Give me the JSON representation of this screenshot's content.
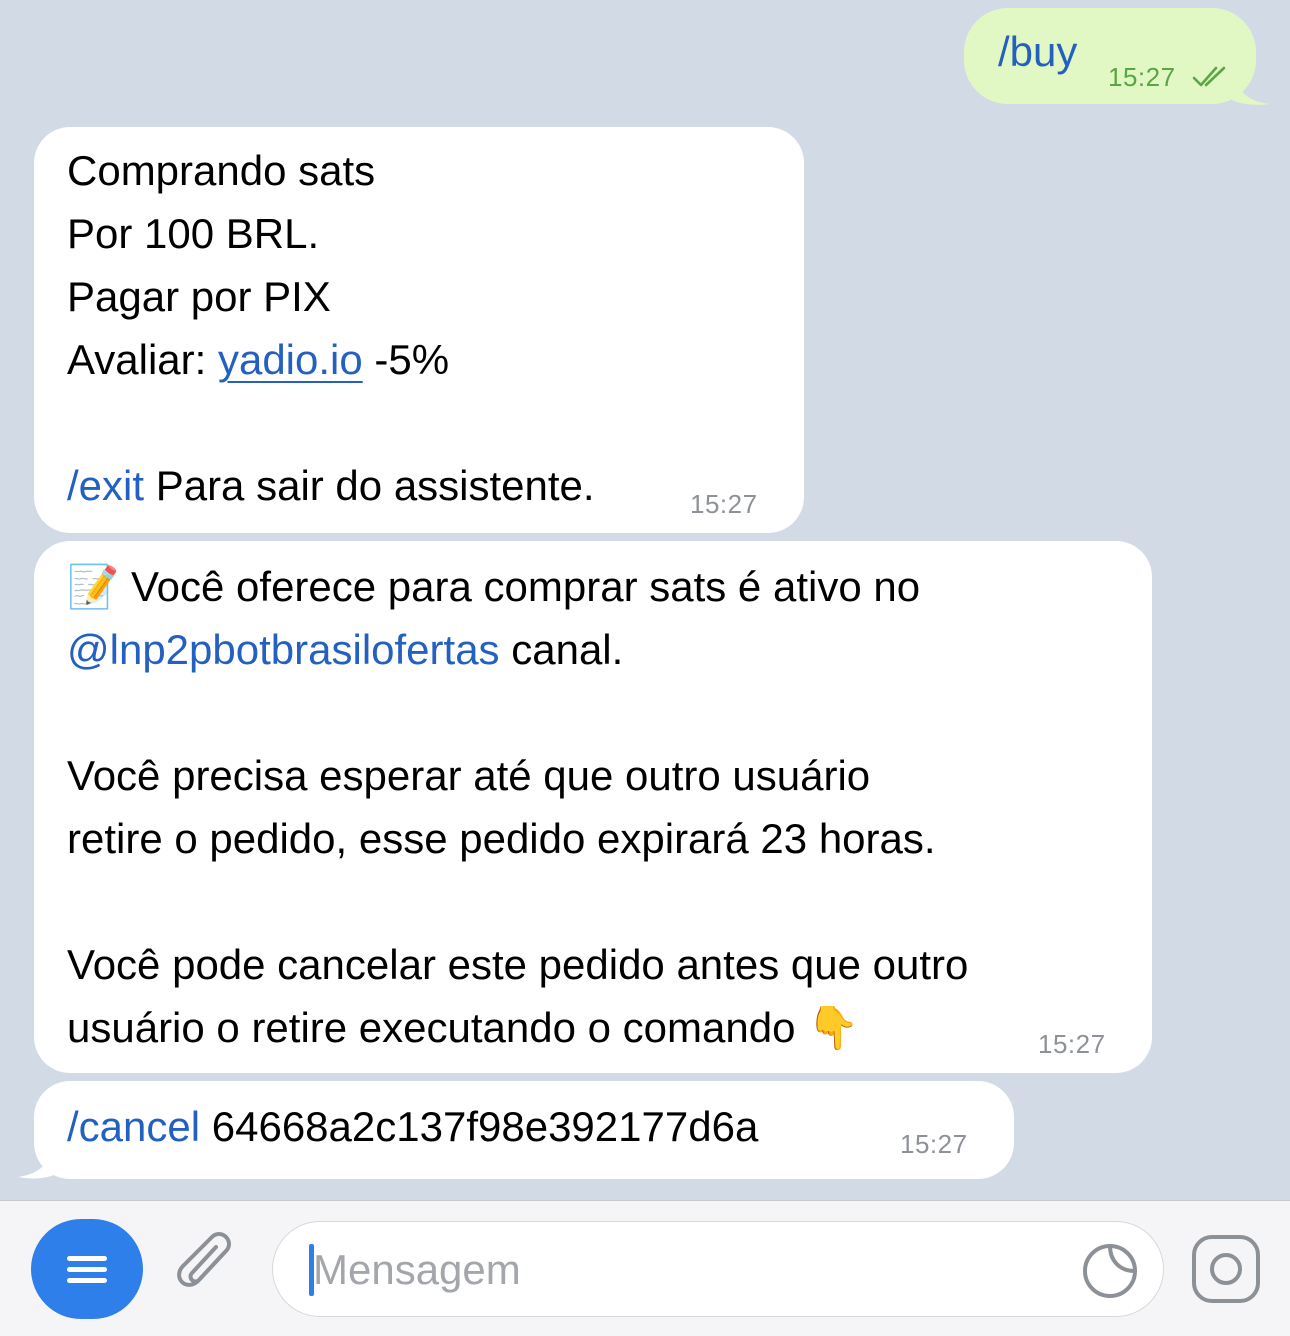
{
  "messages": {
    "outgoing": {
      "text": "/buy",
      "time": "15:27"
    },
    "order_info": {
      "line1": "Comprando sats",
      "line2": "Por 100 BRL.",
      "line3": "Pagar por PIX",
      "line4_prefix": "Avaliar: ",
      "line4_link": "yadio.io",
      "line4_suffix": " -5%",
      "exit_command": "/exit",
      "exit_text": " Para sair do assistente.",
      "time": "15:27"
    },
    "offer_active": {
      "emoji": "📝",
      "line1": " Você oferece para comprar sats é ativo no",
      "channel": "@lnp2pbotbrasilofertas",
      "channel_suffix": " canal.",
      "para2_line1": "Você precisa esperar até que outro usuário",
      "para2_line2": "retire o pedido, esse pedido expirará 23 horas.",
      "para3_line1": "Você pode cancelar este pedido antes que outro",
      "para3_line2": "usuário o retire executando o comando ",
      "pointer_emoji": "👇",
      "time": "15:27"
    },
    "cancel": {
      "command": "/cancel",
      "order_id": " 64668a2c137f98e392177d6a",
      "time": "15:27"
    }
  },
  "input": {
    "placeholder": "Mensagem"
  },
  "colors": {
    "background": "#d2dbe5",
    "outgoing_bubble": "#e1f8c5",
    "incoming_bubble": "#ffffff",
    "link": "#2460c0",
    "accent": "#2f7fea"
  }
}
